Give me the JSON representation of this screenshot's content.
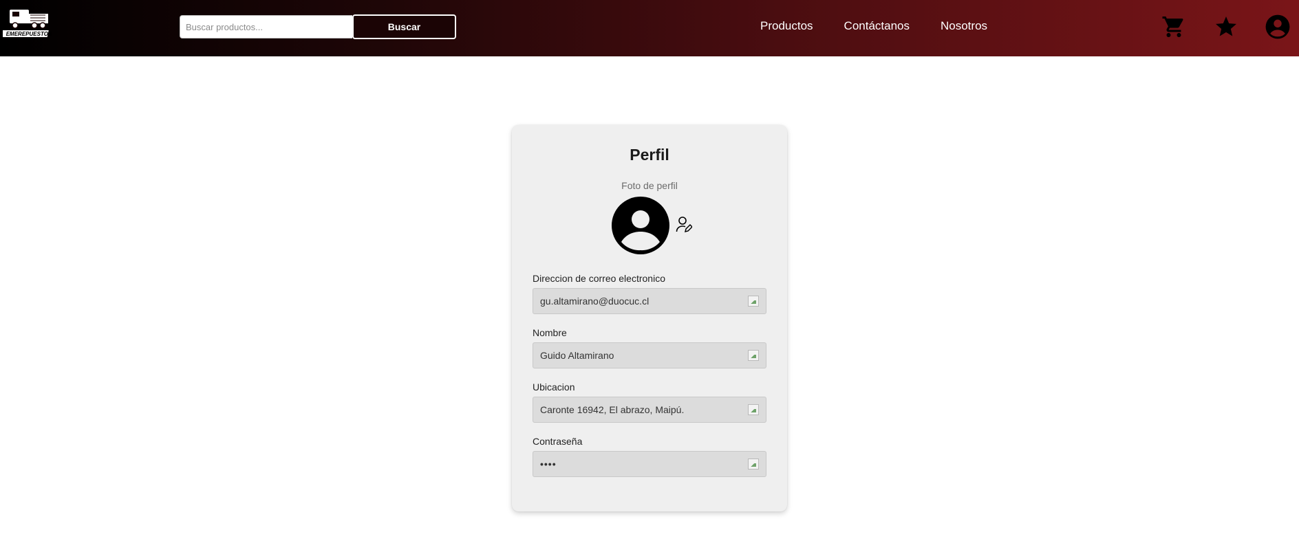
{
  "brand": {
    "logo_text": "EMEREPUESTOS"
  },
  "search": {
    "placeholder": "Buscar productos...",
    "value": "",
    "button_label": "Buscar"
  },
  "nav": {
    "items": [
      {
        "label": "Productos"
      },
      {
        "label": "Contáctanos"
      },
      {
        "label": "Nosotros"
      }
    ]
  },
  "header_icons": [
    "cart-icon",
    "star-icon",
    "account-icon"
  ],
  "colors": {
    "header_start": "#000000",
    "header_end": "#7a1518",
    "card_bg": "#efefef",
    "field_bg": "#dcdcdc"
  },
  "profile": {
    "title": "Perfil",
    "photo_label": "Foto de perfil",
    "fields": [
      {
        "label": "Direccion de correo electronico",
        "value": "gu.altamirano@duocuc.cl"
      },
      {
        "label": "Nombre",
        "value": "Guido Altamirano"
      },
      {
        "label": "Ubicacion",
        "value": "Caronte 16942, El abrazo, Maipú."
      },
      {
        "label": "Contraseña",
        "value": "••••"
      }
    ]
  }
}
